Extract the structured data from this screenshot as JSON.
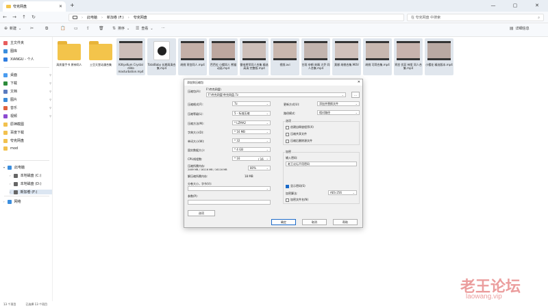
{
  "window": {
    "tab_title": "夸克网盘",
    "new_tab": "+",
    "controls": [
      "—",
      "▢",
      "✕"
    ]
  },
  "address": {
    "path": [
      "此电脑",
      "新加卷 (F:)",
      "夸克网盘"
    ],
    "search_placeholder": "在 夸克网盘 中搜索"
  },
  "toolbar": {
    "new_label": "新建",
    "sort_label": "排序",
    "view_label": "查看",
    "more_label": "···",
    "details_label": "详细信息"
  },
  "sidebar": {
    "items": [
      {
        "label": "主文件夹",
        "color": "#e85d5d"
      },
      {
        "label": "图库",
        "color": "#3b8ede"
      },
      {
        "label": "XIANGU - 个人",
        "color": "#2f7de0"
      },
      {
        "label": "桌面",
        "color": "#4a9cf0",
        "pinned": true
      },
      {
        "label": "下载",
        "color": "#2d8c3c",
        "pinned": true
      },
      {
        "label": "文档",
        "color": "#5a7bbf",
        "pinned": true
      },
      {
        "label": "图片",
        "color": "#3a8bd8",
        "pinned": true
      },
      {
        "label": "音乐",
        "color": "#e0623d",
        "pinned": true
      },
      {
        "label": "视频",
        "color": "#8c4bd1",
        "pinned": true
      },
      {
        "label": "原神截图",
        "color": "#f2c14e"
      },
      {
        "label": "百度下载",
        "color": "#f2c14e"
      },
      {
        "label": "夸克网盘",
        "color": "#f2c14e"
      },
      {
        "label": "mod",
        "color": "#f2c14e"
      },
      {
        "label": "此电脑",
        "color": "#3b8ede"
      },
      {
        "label": "本地磁盘 (C:)",
        "color": "#666666"
      },
      {
        "label": "本地磁盘 (D:)",
        "color": "#666666"
      },
      {
        "label": "新加卷 (F:)",
        "color": "#666666"
      },
      {
        "label": "网络",
        "color": "#3b8ede"
      }
    ]
  },
  "files": [
    {
      "name": "高质量手书 原神同人",
      "kind": "folder"
    },
    {
      "name": "土豆天堂动漫合集",
      "kind": "folder"
    },
    {
      "name": "KittyxKum Crystal dildo masturbation.mp4",
      "kind": "video"
    },
    {
      "name": "TotalBaby 长期高清合集.mp4",
      "kind": "app"
    },
    {
      "name": "胡桃 宵宫同人.mp4",
      "kind": "video"
    },
    {
      "name": "芭芭拉 小樱同人 熊猫动画.mp4",
      "kind": "video"
    },
    {
      "name": "雷电将军同人合集 精选 高清 完整版.mp4",
      "kind": "video"
    },
    {
      "name": "视频.avi",
      "kind": "video"
    },
    {
      "name": "甘雨 申鹤 刻晴 大乔 同人合集.mp4",
      "kind": "video"
    },
    {
      "name": "莫娜 胡桃合集.MOV",
      "kind": "video"
    },
    {
      "name": "胡桃 可莉合集.mp4",
      "kind": "video"
    },
    {
      "name": "宵宫 优菈 神里 同人合集.mp4",
      "kind": "video"
    },
    {
      "name": "小樱花 精选版本.mp4",
      "kind": "video"
    }
  ],
  "status": {
    "count": "13 个项目",
    "selected": "已选择 13 个项目"
  },
  "watermark": {
    "cn": "老王论坛",
    "url": "laowang.vip"
  },
  "dialog": {
    "title": "添加到压缩包",
    "close": "✕",
    "archive_label": "压缩包(A):",
    "archive_dir": "F:\\夸克网盘\\",
    "archive_value": "F:\\夸克网盘\\夸克网盘.7z",
    "browse": "...",
    "format_label": "压缩格式(F):",
    "format_value": "7z",
    "level_label": "压缩等级(L):",
    "level_value": "5 - 标准压缩",
    "method_label": "压缩方法(M):",
    "method_value": "* LZMA2",
    "dict_label": "字典大小(D):",
    "dict_value": "* 16 MB",
    "word_label": "单词大小(W):",
    "word_value": "* 32",
    "solid_label": "固实数据大小:",
    "solid_value": "* 4 GB",
    "cpu_label": "CPU线程数:",
    "cpu_value": "* 16",
    "cpu_total": "/ 16",
    "mem_label": "压缩所需内存:",
    "mem_detail": "2469 MB / 16116 MB / 16116 MB",
    "mem_pct": "80%",
    "decomp_label": "解压缩所需内存:",
    "decomp_value": "18 MB",
    "split_label": "分卷大小，字节(V):",
    "params_label": "参数(P):",
    "options_btn": "选项",
    "update_label": "更新方式(U):",
    "update_value": "添加并替换文件",
    "path_label": "路径模式:",
    "path_value": "相对路径",
    "options_group": "选项",
    "opt1": "创建自释放程序(X)",
    "opt2": "压缩共享文件",
    "opt3": "压缩后删除源文件",
    "enc_group": "加密",
    "pwd_label": "输入密码:",
    "pwd_value": "老王论坛不用密码",
    "show_pwd": "显示密码(S)",
    "enc_method_label": "加密算法:",
    "enc_method_value": "AES-256",
    "enc_names": "加密文件名(N)",
    "ok": "确定",
    "cancel": "取消",
    "help": "帮助"
  }
}
